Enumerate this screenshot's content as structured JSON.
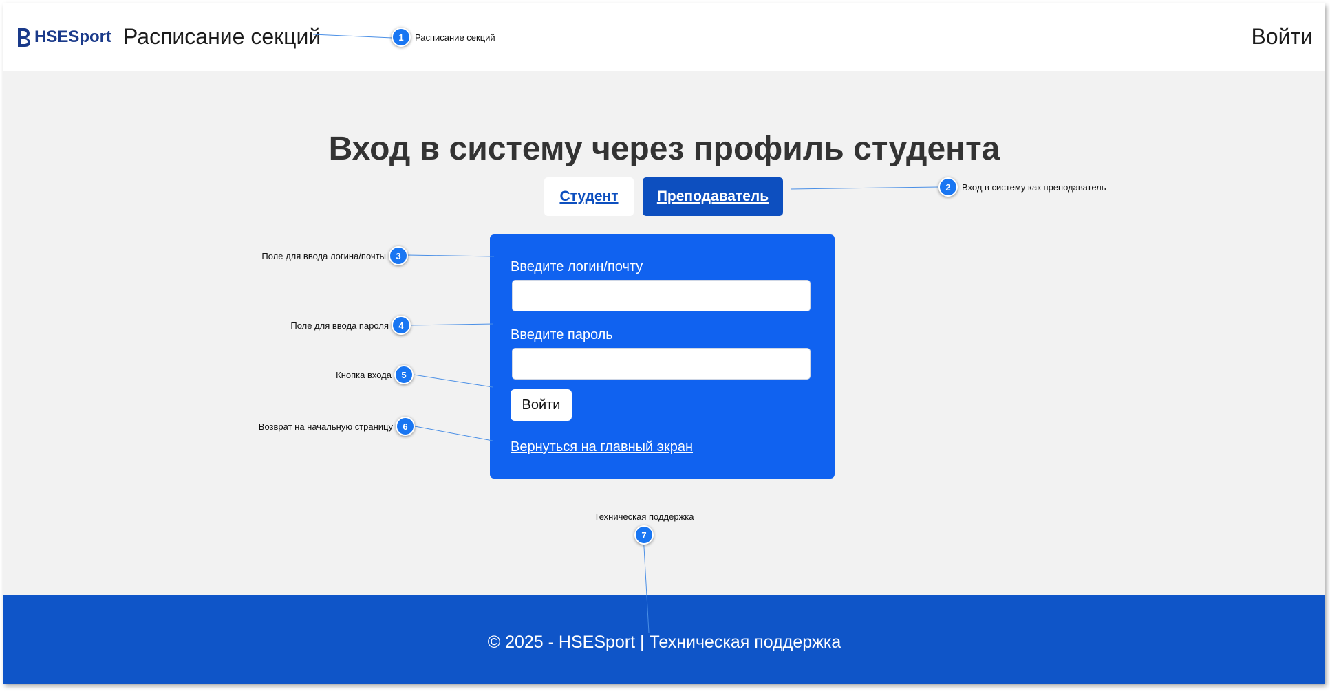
{
  "header": {
    "logo_text": "HSESport",
    "nav_schedule": "Расписание секций",
    "nav_login": "Войти"
  },
  "main": {
    "title": "Вход в систему через профиль студента",
    "tabs": [
      {
        "label": "Студент",
        "active": false
      },
      {
        "label": "Преподаватель",
        "active": true
      }
    ],
    "form": {
      "login_label": "Введите логин/почту",
      "login_value": "",
      "password_label": "Введите пароль",
      "password_value": "",
      "submit_label": "Войти",
      "back_link": "Вернуться на главный экран"
    }
  },
  "footer": {
    "text": "© 2025 - HSESport | Техническая поддержка"
  },
  "annotations": [
    {
      "number": "1",
      "text": "Расписание секций"
    },
    {
      "number": "2",
      "text": "Вход в систему как преподаватель"
    },
    {
      "number": "3",
      "text": "Поле для ввода логина/почты"
    },
    {
      "number": "4",
      "text": "Поле для ввода пароля"
    },
    {
      "number": "5",
      "text": "Кнопка входа"
    },
    {
      "number": "6",
      "text": "Возврат на начальную страницу"
    },
    {
      "number": "7",
      "text": "Техническая поддержка"
    }
  ],
  "colors": {
    "primary_blue": "#1062f0",
    "tab_active": "#0d4fbf",
    "footer_blue": "#0f55c8",
    "callout_blue": "#1976f2",
    "page_background": "#f2f2f2"
  },
  "icons": {
    "logo": "hse-logo-icon"
  }
}
